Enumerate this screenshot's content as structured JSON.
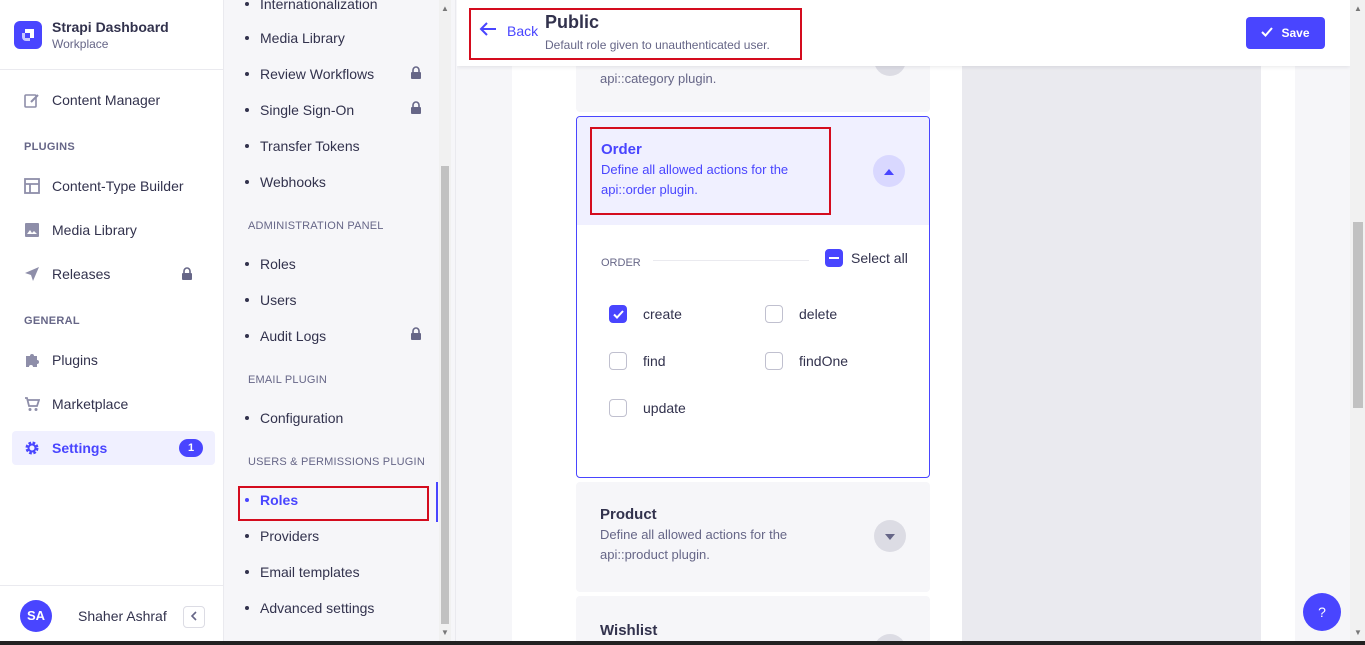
{
  "brand": {
    "title": "Strapi Dashboard",
    "subtitle": "Workplace"
  },
  "mainnav": {
    "content_manager": "Content Manager",
    "plugins_section": "PLUGINS",
    "content_type_builder": "Content-Type Builder",
    "media_library": "Media Library",
    "releases": "Releases",
    "general_section": "GENERAL",
    "plugins": "Plugins",
    "marketplace": "Marketplace",
    "settings": "Settings",
    "settings_badge": "1"
  },
  "user": {
    "initials": "SA",
    "name": "Shaher Ashraf"
  },
  "subnav": {
    "internationalization": "Internationalization",
    "media_library": "Media Library",
    "review_workflows": "Review Workflows",
    "single_sign_on": "Single Sign-On",
    "transfer_tokens": "Transfer Tokens",
    "webhooks": "Webhooks",
    "admin_section": "ADMINISTRATION PANEL",
    "roles": "Roles",
    "users": "Users",
    "audit_logs": "Audit Logs",
    "email_section": "EMAIL PLUGIN",
    "configuration": "Configuration",
    "up_section": "USERS & PERMISSIONS PLUGIN",
    "up_roles": "Roles",
    "providers": "Providers",
    "email_templates": "Email templates",
    "advanced_settings": "Advanced settings"
  },
  "header": {
    "back": "Back",
    "title": "Public",
    "subtitle": "Default role given to unauthenticated user.",
    "save": "Save"
  },
  "accordions": {
    "category_desc_tail": "api::category plugin.",
    "order": {
      "title": "Order",
      "desc": "Define all allowed actions for the api::order plugin.",
      "section_label": "ORDER",
      "select_all": "Select all",
      "perms": {
        "create": {
          "label": "create",
          "checked": true
        },
        "delete": {
          "label": "delete",
          "checked": false
        },
        "find": {
          "label": "find",
          "checked": false
        },
        "findOne": {
          "label": "findOne",
          "checked": false
        },
        "update": {
          "label": "update",
          "checked": false
        }
      }
    },
    "product": {
      "title": "Product",
      "desc": "Define all allowed actions for the api::product plugin."
    },
    "wishlist": {
      "title": "Wishlist"
    }
  },
  "help": "?",
  "colors": {
    "primary": "#4945ff",
    "highlight": "#d40c1e"
  },
  "icons": [
    "strapi-logo-icon",
    "pencil-icon",
    "layout-icon",
    "image-icon",
    "paper-plane-icon",
    "lock-icon",
    "puzzle-icon",
    "cart-icon",
    "gear-icon",
    "chevron-left-icon",
    "arrow-left-icon",
    "check-icon",
    "chevron-up-icon",
    "chevron-down-icon"
  ]
}
